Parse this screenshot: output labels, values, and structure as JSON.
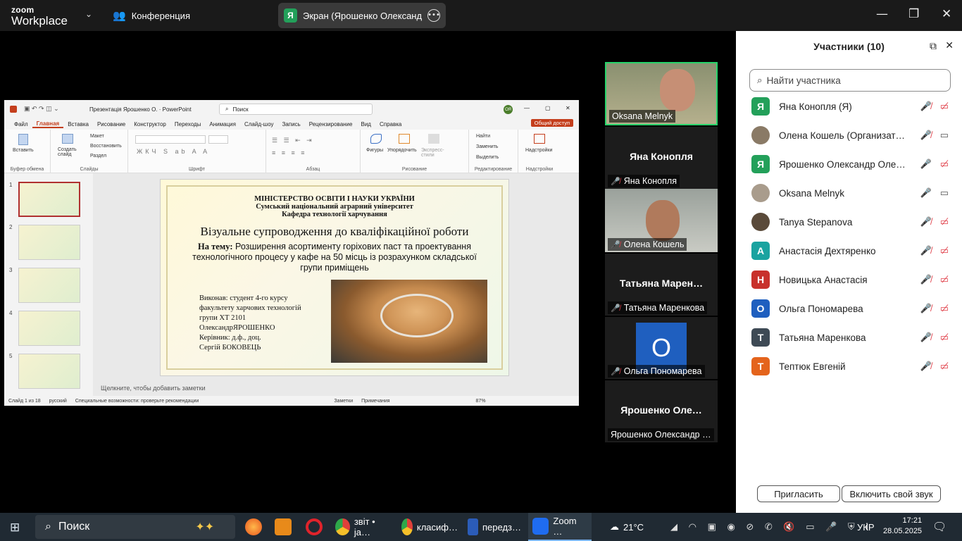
{
  "topbar": {
    "logo_line1": "zoom",
    "logo_line2": "Workplace",
    "conference": "Конференция",
    "share_initial": "Я",
    "share_title": "Экран (Ярошенко Олександр Ол"
  },
  "ppt": {
    "file_title": "Презентація Ярошенко О. · PowerPoint",
    "search": "Поиск",
    "user": "ОЯ",
    "menu": [
      "Файл",
      "Главная",
      "Вставка",
      "Рисование",
      "Конструктор",
      "Переходы",
      "Анимация",
      "Слайд-шоу",
      "Запись",
      "Рецензирование",
      "Вид",
      "Справка"
    ],
    "share": "Общий доступ",
    "groups": {
      "clipboard": "Буфер обмена",
      "slides": "Слайды",
      "font": "Шрифт",
      "paragraph": "Абзац",
      "drawing": "Рисование",
      "editing": "Редактирование",
      "addins": "Надстройки"
    },
    "buttons": {
      "paste": "Вставить",
      "new_slide": "Создать слайд",
      "layout": "Макет",
      "reset": "Восстановить",
      "section": "Раздел",
      "shapes": "Фигуры",
      "arrange": "Упорядочить",
      "quick_styles": "Экспресс-стили",
      "find": "Найти",
      "replace": "Заменить",
      "select": "Выделить",
      "addins": "Надстройки"
    },
    "thumb_nums": [
      "1",
      "2",
      "3",
      "4",
      "5"
    ],
    "slide": {
      "ministry": "МІНІСТЕРСТВО ОСВІТИ І НАУКИ УКРАЇНИ",
      "university": "Сумський національний аграрний університет",
      "dept": "Кафедра технології харчування",
      "title": "Візуальне супроводження до кваліфікаційної роботи",
      "topic_label": "На тему:",
      "topic": "Розширення асортименту горіхових паст та проектування технологічного процесу у кафе на 50 місць із розрахунком складської групи приміщень",
      "author": [
        "Виконав: студент 4-го курсу",
        "факультету харчових технологій",
        "групи ХТ 2101",
        "ОлександрЯРОШЕНКО",
        "Керівник: д.ф., доц.",
        "Сергій БОКОВЕЦЬ"
      ]
    },
    "notes": "Щелкните, чтобы добавить заметки",
    "status": {
      "slide": "Слайд 1 из 18",
      "lang": "русский",
      "access": "Специальные возможности: проверьте рекомендации",
      "notes": "Заметки",
      "comments": "Примечания",
      "zoom": "87%"
    }
  },
  "videos": {
    "t1": "Oksana Melnyk",
    "t2_big": "Яна Конопля",
    "t2": "Яна Конопля",
    "t3": "Олена Кошель",
    "t4_big": "Татьяна  Марен…",
    "t4": "Татьяна Маренкова",
    "t5_initial": "О",
    "t5": "Ольга Пономарева",
    "t6_big": "Ярошенко  Оле…",
    "t6": "Ярошенко Олександр …"
  },
  "panel": {
    "title": "Участники (10)",
    "search_placeholder": "Найти участника",
    "participants": [
      {
        "initial": "Я",
        "name": "Яна Конопля (Я)",
        "color": "#23a05a"
      },
      {
        "initial": "",
        "name": "Олена Кошель (Организатор)",
        "color": "#8a7a66"
      },
      {
        "initial": "Я",
        "name": "Ярошенко Олександр Олег…",
        "color": "#23a05a"
      },
      {
        "initial": "",
        "name": "Oksana Melnyk",
        "color": "#a99c8c"
      },
      {
        "initial": "",
        "name": "Tanya Stepanova",
        "color": "#5a4a3a"
      },
      {
        "initial": "А",
        "name": "Анастасія Дехтяренко",
        "color": "#1aa3a0"
      },
      {
        "initial": "Н",
        "name": "Новицька Анастасія",
        "color": "#c8322c"
      },
      {
        "initial": "О",
        "name": "Ольга Пономарева",
        "color": "#1f5fbf"
      },
      {
        "initial": "Т",
        "name": "Татьяна Маренкова",
        "color": "#3e4a55"
      },
      {
        "initial": "Т",
        "name": "Тептюк Евгеній",
        "color": "#e4641c"
      }
    ],
    "invite": "Пригласить",
    "unmute": "Включить свой звук"
  },
  "taskbar": {
    "search": "Поиск",
    "apps": [
      "звіт • ја…",
      "класиф…",
      "передз…",
      "Zoom …"
    ],
    "weather": "21°C",
    "lang": "УКР",
    "time": "17:21",
    "date": "28.05.2025"
  }
}
